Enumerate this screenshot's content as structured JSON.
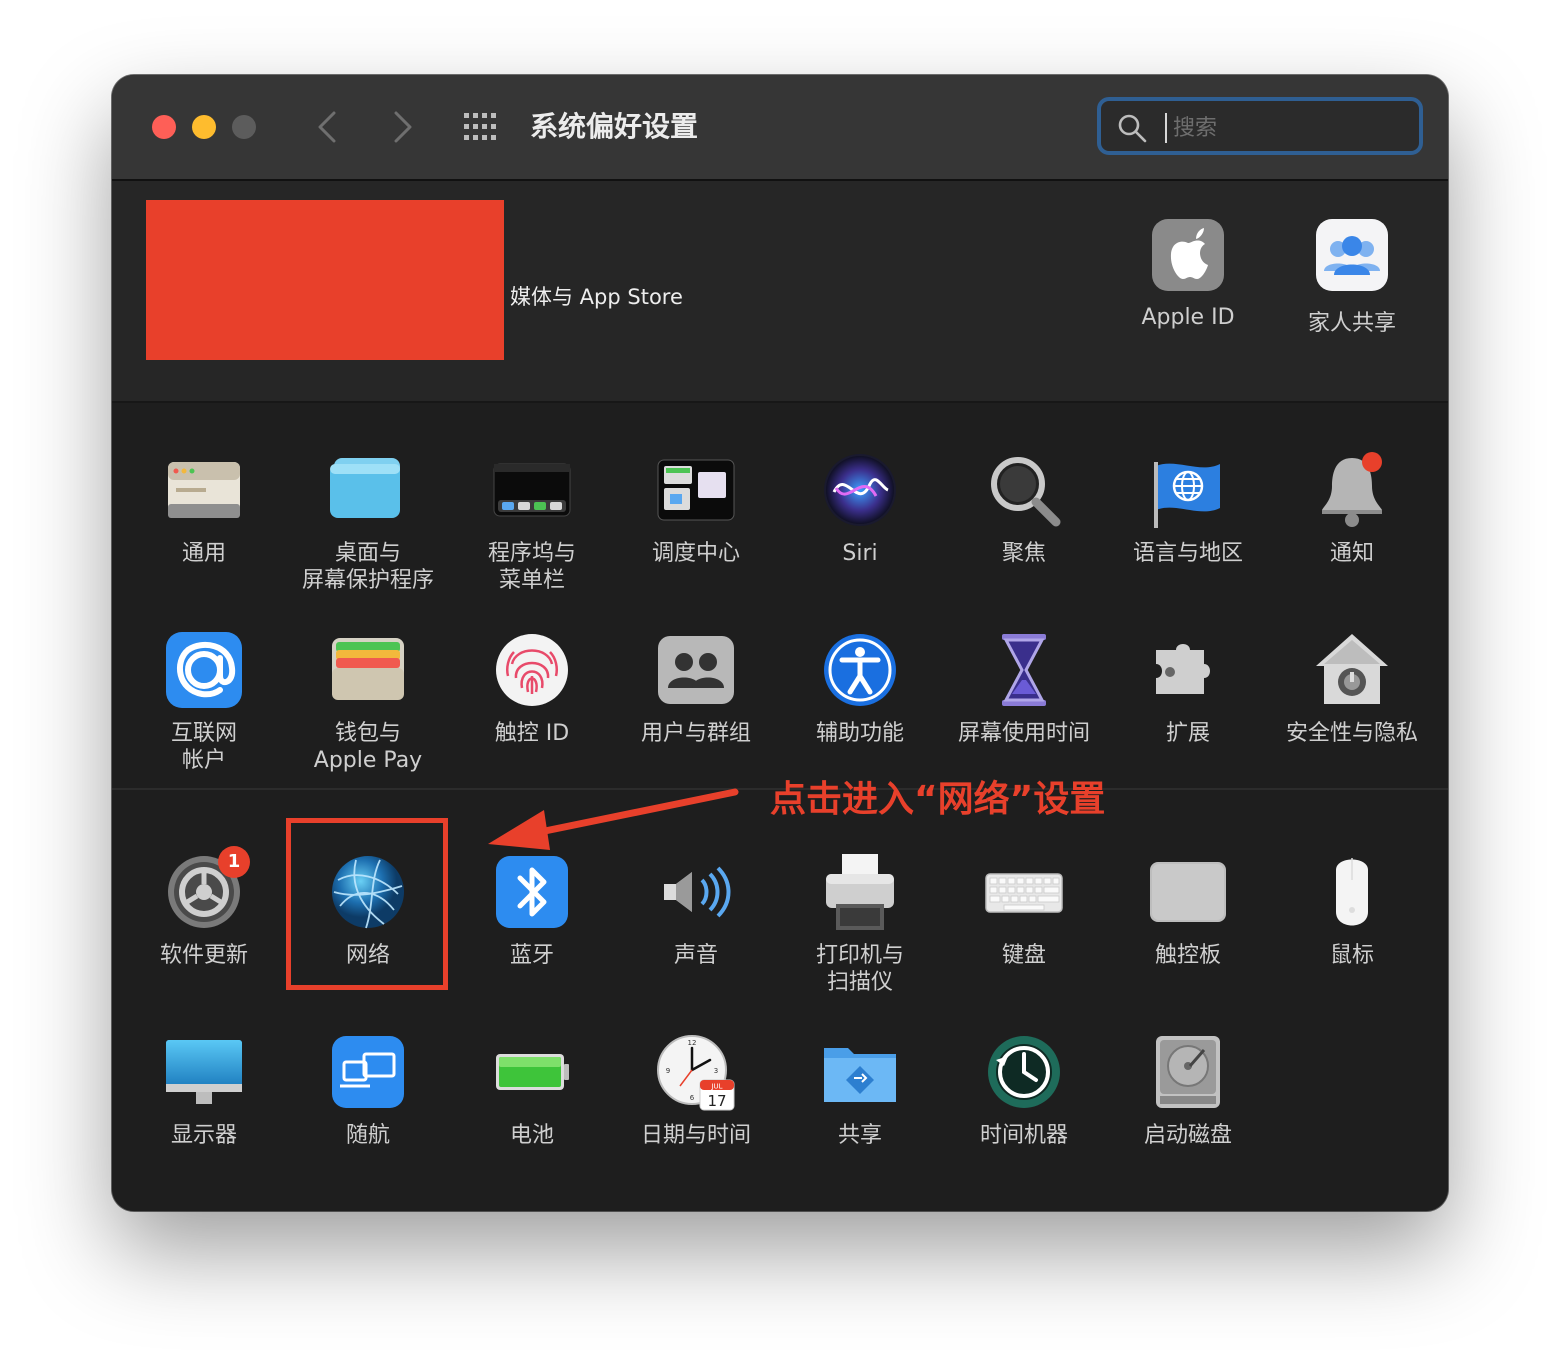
{
  "window": {
    "title": "系统偏好设置",
    "search_placeholder": "搜索"
  },
  "account": {
    "text": "媒体与 App Store",
    "items": [
      {
        "name": "apple-id",
        "label": "Apple ID",
        "icon": "apple-logo-icon"
      },
      {
        "name": "family-sharing",
        "label": "家人共享",
        "icon": "family-sharing-icon"
      }
    ]
  },
  "rows": [
    [
      {
        "key": "general",
        "lines": [
          "通用"
        ],
        "icon": "general-icon"
      },
      {
        "key": "desktop",
        "lines": [
          "桌面与",
          "屏幕保护程序"
        ],
        "icon": "desktop-screensaver-icon"
      },
      {
        "key": "dock",
        "lines": [
          "程序坞与",
          "菜单栏"
        ],
        "icon": "dock-menubar-icon"
      },
      {
        "key": "mission",
        "lines": [
          "调度中心"
        ],
        "icon": "mission-control-icon"
      },
      {
        "key": "siri",
        "lines": [
          "Siri"
        ],
        "icon": "siri-icon"
      },
      {
        "key": "spotlight",
        "lines": [
          "聚焦"
        ],
        "icon": "spotlight-icon"
      },
      {
        "key": "language",
        "lines": [
          "语言与地区"
        ],
        "icon": "language-region-icon"
      },
      {
        "key": "notifications",
        "lines": [
          "通知"
        ],
        "icon": "notifications-icon"
      }
    ],
    [
      {
        "key": "internet",
        "lines": [
          "互联网",
          "帐户"
        ],
        "icon": "internet-accounts-icon"
      },
      {
        "key": "wallet",
        "lines": [
          "钱包与",
          "Apple Pay"
        ],
        "icon": "wallet-icon"
      },
      {
        "key": "touchid",
        "lines": [
          "触控 ID"
        ],
        "icon": "touch-id-icon"
      },
      {
        "key": "users",
        "lines": [
          "用户与群组"
        ],
        "icon": "users-groups-icon"
      },
      {
        "key": "accessibility",
        "lines": [
          "辅助功能"
        ],
        "icon": "accessibility-icon"
      },
      {
        "key": "screentime",
        "lines": [
          "屏幕使用时间"
        ],
        "icon": "screen-time-icon"
      },
      {
        "key": "extensions",
        "lines": [
          "扩展"
        ],
        "icon": "extensions-icon"
      },
      {
        "key": "security",
        "lines": [
          "安全性与隐私"
        ],
        "icon": "security-privacy-icon"
      }
    ],
    [
      {
        "key": "update",
        "lines": [
          "软件更新"
        ],
        "icon": "software-update-icon",
        "badge": "1"
      },
      {
        "key": "network",
        "lines": [
          "网络"
        ],
        "icon": "network-icon"
      },
      {
        "key": "bluetooth",
        "lines": [
          "蓝牙"
        ],
        "icon": "bluetooth-icon"
      },
      {
        "key": "sound",
        "lines": [
          "声音"
        ],
        "icon": "sound-icon"
      },
      {
        "key": "printers",
        "lines": [
          "打印机与",
          "扫描仪"
        ],
        "icon": "printers-scanners-icon"
      },
      {
        "key": "keyboard",
        "lines": [
          "键盘"
        ],
        "icon": "keyboard-icon"
      },
      {
        "key": "trackpad",
        "lines": [
          "触控板"
        ],
        "icon": "trackpad-icon"
      },
      {
        "key": "mouse",
        "lines": [
          "鼠标"
        ],
        "icon": "mouse-icon"
      }
    ],
    [
      {
        "key": "displays",
        "lines": [
          "显示器"
        ],
        "icon": "displays-icon"
      },
      {
        "key": "sidecar",
        "lines": [
          "随航"
        ],
        "icon": "sidecar-icon"
      },
      {
        "key": "battery",
        "lines": [
          "电池"
        ],
        "icon": "battery-icon"
      },
      {
        "key": "datetime",
        "lines": [
          "日期与时间"
        ],
        "icon": "date-time-icon",
        "cal_month": "JUL",
        "cal_day": "17"
      },
      {
        "key": "sharing",
        "lines": [
          "共享"
        ],
        "icon": "sharing-icon"
      },
      {
        "key": "timemachine",
        "lines": [
          "时间机器"
        ],
        "icon": "time-machine-icon"
      },
      {
        "key": "startup",
        "lines": [
          "启动磁盘"
        ],
        "icon": "startup-disk-icon"
      }
    ]
  ],
  "annotation": {
    "text": "点击进入“网络”设置",
    "color": "#e8402b"
  }
}
